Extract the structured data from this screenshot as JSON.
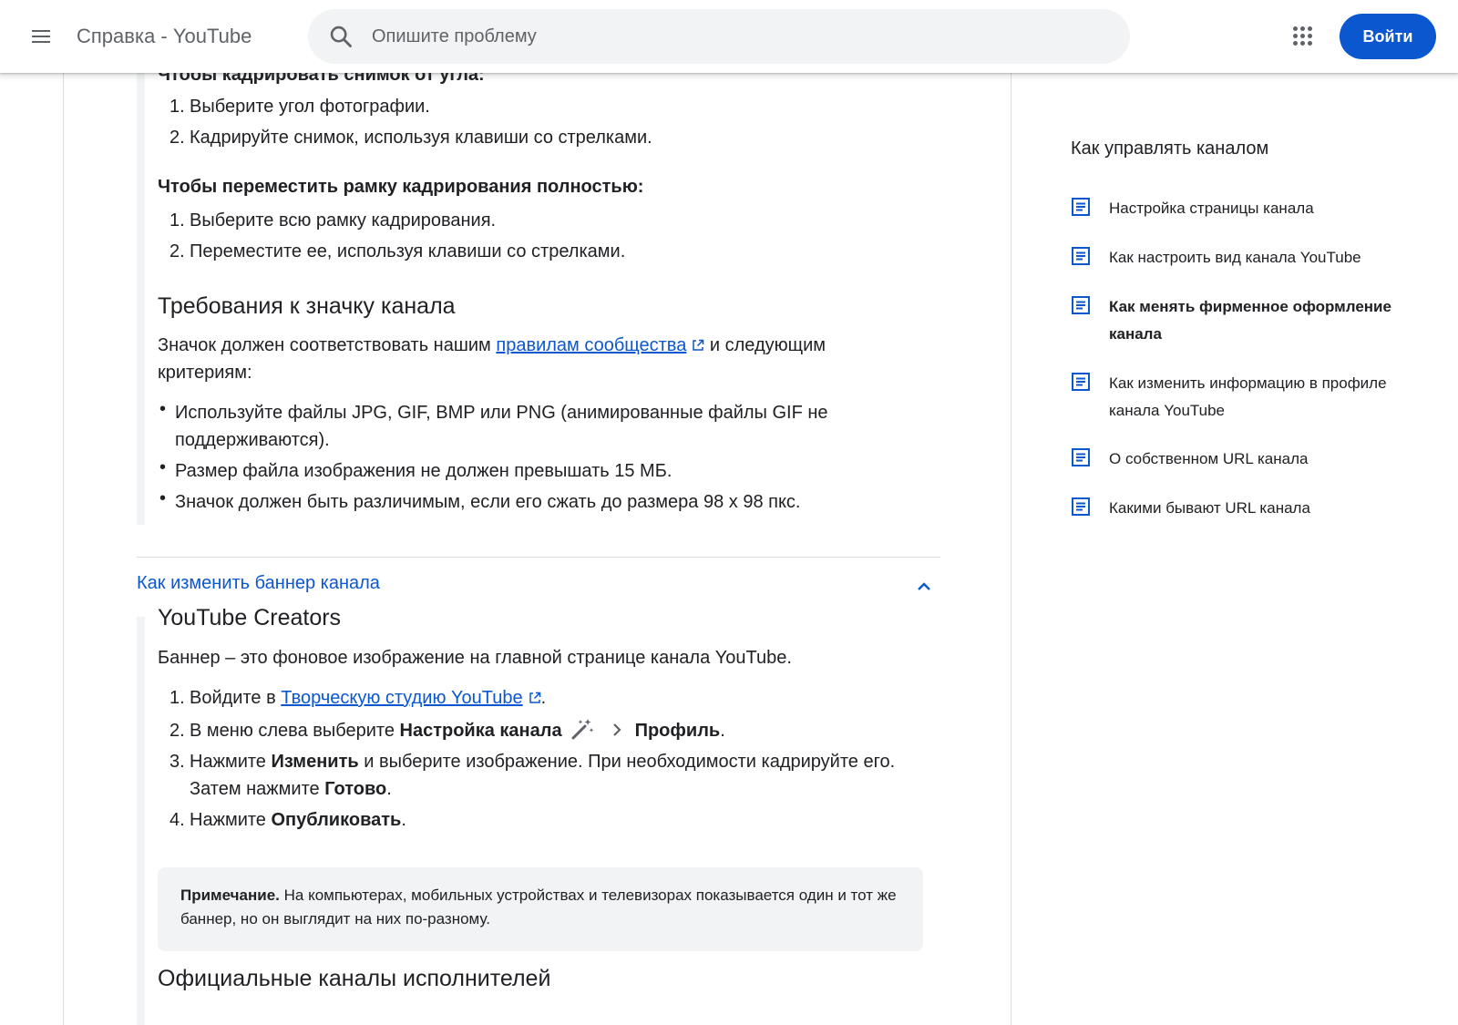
{
  "header": {
    "title": "Справка - YouTube",
    "search_placeholder": "Опишите проблему",
    "signin_label": "Войти"
  },
  "article": {
    "corner_heading": "Чтобы кадрировать снимок от угла:",
    "corner_steps": [
      "Выберите угол фотографии.",
      "Кадрируйте снимок, используя клавиши со стрелками."
    ],
    "move_heading": "Чтобы переместить рамку кадрирования полностью:",
    "move_steps": [
      "Выберите всю рамку кадрирования.",
      "Переместите ее, используя клавиши со стрелками."
    ],
    "icon_req_title": "Требования к значку канала",
    "icon_req_intro_before": "Значок должен соответствовать нашим ",
    "icon_req_link": "правилам сообщества",
    "icon_req_intro_after": " и следующим",
    "icon_req_intro_line2": "критериям:",
    "icon_req_bullets": [
      "Используйте файлы JPG, GIF, BMP или PNG (анимированные файлы GIF не",
      "поддерживаются).",
      "Размер файла изображения не должен превышать 15 МБ.",
      "Значок должен быть различимым, если его сжать до размера 98 x 98 пкс."
    ],
    "banner_accordion_title": "Как изменить баннер канала",
    "creators_title": "YouTube Creators",
    "banner_intro": "Баннер – это фоновое изображение на главной странице канала YouTube.",
    "step1_before": "Войдите в ",
    "step1_link": "Творческую студию YouTube",
    "step1_after": ".",
    "step2_before": "В меню слева выберите ",
    "step2_bold1": "Настройка канала",
    "step2_bold2": "Профиль",
    "step2_after": ".",
    "step3_before": "Нажмите ",
    "step3_bold1": "Изменить",
    "step3_mid": " и выберите изображение. При необходимости кадрируйте его.",
    "step3_line2_before": "Затем нажмите ",
    "step3_bold2": "Готово",
    "step3_after": ".",
    "step4_before": "Нажмите ",
    "step4_bold": "Опубликовать",
    "step4_after": ".",
    "note_bold": "Примечание.",
    "note_text": " На компьютерах, мобильных устройствах и телевизорах показывается один и тот же баннер, но он выглядит на них по-разному.",
    "artists_title": "Официальные каналы исполнителей"
  },
  "sidebar": {
    "title": "Как управлять каналом",
    "items": [
      {
        "label": "Настройка страницы канала",
        "active": false
      },
      {
        "label": "Как настроить вид канала YouTube",
        "active": false
      },
      {
        "label": "Как менять фирменное оформление канала",
        "active": true
      },
      {
        "label": "Как изменить информацию в профиле канала YouTube",
        "active": false
      },
      {
        "label": "О собственном URL канала",
        "active": false
      },
      {
        "label": "Какими бывают URL канала",
        "active": false
      }
    ]
  },
  "colors": {
    "accent": "#0b57d0",
    "text": "#202124",
    "muted": "#5f6368"
  },
  "icons": [
    "menu-icon",
    "search-icon",
    "apps-icon",
    "external-link-icon",
    "chevron-up-icon",
    "magic-wand-icon",
    "chevron-right-icon",
    "article-icon"
  ]
}
